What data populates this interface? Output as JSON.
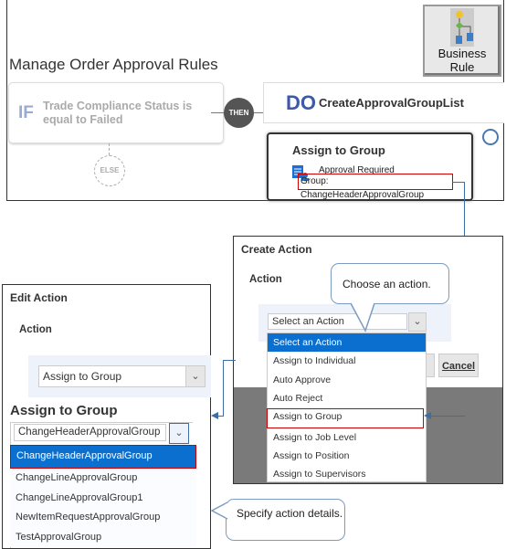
{
  "rule_editor": {
    "title": "Manage Order Approval Rules",
    "business_rule_button": "Business Rule",
    "if_keyword": "IF",
    "condition": "Trade Compliance Status is equal to Failed",
    "then_label": "THEN",
    "else_label": "ELSE",
    "do_keyword": "DO",
    "do_name": "CreateApprovalGroupList",
    "action_card": {
      "title": "Assign to Group",
      "line1": "Approval Required",
      "line2": "Group: ChangeHeaderApprovalGroup"
    }
  },
  "create_action": {
    "title": "Create Action",
    "action_label": "Action",
    "select_value": "Select an Action",
    "options": [
      "Select an Action",
      "Assign to Individual",
      "Auto Approve",
      "Auto Reject",
      "Assign to Group",
      "Assign to Job Level",
      "Assign to Position",
      "Assign to Supervisors"
    ],
    "selected_index": 0,
    "highlighted_index": 4,
    "cancel_label": "Cancel",
    "ok_partial": "K",
    "callout": "Choose an action."
  },
  "edit_action": {
    "title": "Edit Action",
    "action_label": "Action",
    "action_value": "Assign to Group",
    "section_title": "Assign to Group",
    "group_value": "ChangeHeaderApprovalGroup",
    "groups": [
      "ChangeHeaderApprovalGroup",
      "ChangeLineApprovalGroup",
      "ChangeLineApprovalGroup1",
      "NewItemRequestApprovalGroup",
      "TestApprovalGroup"
    ],
    "selected_index": 0,
    "callout": "Specify action details."
  },
  "colors": {
    "selection": "#0b6fd0",
    "highlight_border": "#cc0000",
    "connector": "#3d6ea3",
    "do_keyword": "#3c5aa8"
  }
}
